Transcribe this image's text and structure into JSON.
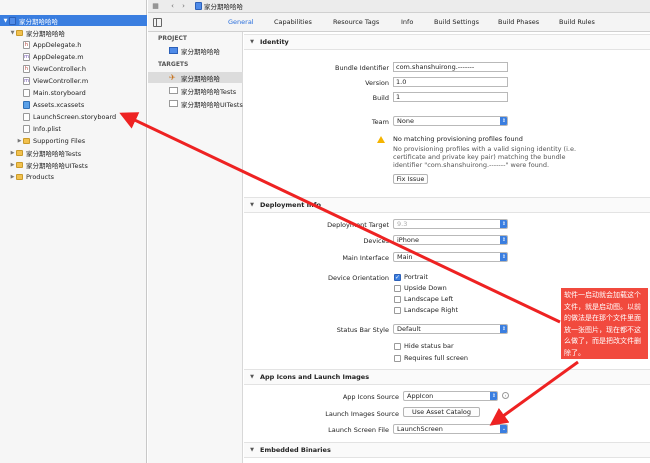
{
  "navigator": {
    "items": [
      {
        "label": "家分期哈哈哈",
        "icon": "project",
        "depth": 0,
        "expanded": true,
        "selected": true
      },
      {
        "label": "家分期哈哈哈",
        "icon": "folder",
        "depth": 1,
        "expanded": true
      },
      {
        "label": "AppDelegate.h",
        "icon": "h",
        "depth": 2
      },
      {
        "label": "AppDelegate.m",
        "icon": "m",
        "depth": 2
      },
      {
        "label": "ViewController.h",
        "icon": "h",
        "depth": 2
      },
      {
        "label": "ViewController.m",
        "icon": "m",
        "depth": 2
      },
      {
        "label": "Main.storyboard",
        "icon": "sb",
        "depth": 2
      },
      {
        "label": "Assets.xcassets",
        "icon": "assets",
        "depth": 2
      },
      {
        "label": "LaunchScreen.storyboard",
        "icon": "sb",
        "depth": 2
      },
      {
        "label": "Info.plist",
        "icon": "plist",
        "depth": 2
      },
      {
        "label": "Supporting Files",
        "icon": "folder",
        "depth": 2,
        "expanded": false
      },
      {
        "label": "家分期哈哈哈Tests",
        "icon": "folder",
        "depth": 1,
        "expanded": false
      },
      {
        "label": "家分期哈哈哈UITests",
        "icon": "folder",
        "depth": 1,
        "expanded": false
      },
      {
        "label": "Products",
        "icon": "folder",
        "depth": 1,
        "expanded": false
      }
    ]
  },
  "toolbar": {
    "grid_icon": "grid-icon",
    "back_icon": "chevron-left-icon",
    "forward_icon": "chevron-right-icon",
    "breadcrumb": "家分期哈哈哈"
  },
  "tabs": [
    {
      "label": "General",
      "active": true
    },
    {
      "label": "Capabilities"
    },
    {
      "label": "Resource Tags"
    },
    {
      "label": "Info"
    },
    {
      "label": "Build Settings"
    },
    {
      "label": "Build Phases"
    },
    {
      "label": "Build Rules"
    }
  ],
  "targets_pane": {
    "project_header": "PROJECT",
    "project_item": "家分期哈哈哈",
    "targets_header": "TARGETS",
    "targets": [
      {
        "label": "家分期哈哈哈",
        "selected": true
      },
      {
        "label": "家分期哈哈哈Tests"
      },
      {
        "label": "家分期哈哈哈UITests"
      }
    ]
  },
  "identity": {
    "title": "Identity",
    "bundle_identifier_label": "Bundle Identifier",
    "bundle_identifier": "com.shanshuirong.-------",
    "version_label": "Version",
    "version": "1.0",
    "build_label": "Build",
    "build": "1",
    "team_label": "Team",
    "team": "None",
    "warning_title": "No matching provisioning profiles found",
    "warning_text": "No provisioning profiles with a valid signing identity (i.e. certificate and private key pair) matching the bundle identifier \"com.shanshuirong.-------\" were found.",
    "fix_issue": "Fix Issue"
  },
  "deployment": {
    "title": "Deployment Info",
    "target_label": "Deployment Target",
    "target": "9.3",
    "devices_label": "Devices",
    "devices": "iPhone",
    "main_interface_label": "Main Interface",
    "main_interface": "Main",
    "orientation_label": "Device Orientation",
    "orientations": [
      {
        "label": "Portrait",
        "checked": true
      },
      {
        "label": "Upside Down",
        "checked": false
      },
      {
        "label": "Landscape Left",
        "checked": false
      },
      {
        "label": "Landscape Right",
        "checked": false
      }
    ],
    "status_bar_label": "Status Bar Style",
    "status_bar": "Default",
    "status_options": [
      {
        "label": "Hide status bar",
        "checked": false
      },
      {
        "label": "Requires full screen",
        "checked": false
      }
    ]
  },
  "app_icons": {
    "title": "App Icons and Launch Images",
    "icons_source_label": "App Icons Source",
    "icons_source": "AppIcon",
    "launch_images_label": "Launch Images Source",
    "use_asset_catalog": "Use Asset Catalog",
    "launch_screen_label": "Launch Screen File",
    "launch_screen": "LaunchScreen"
  },
  "embedded": {
    "title": "Embedded Binaries"
  },
  "annotation": {
    "text": "软件一启动就会加载这个文件，就是启动图。以前的做法是在那个文件里面放一张图片，现在都不这么做了，而是把改文件删除了。",
    "color": "#f14a3e"
  }
}
